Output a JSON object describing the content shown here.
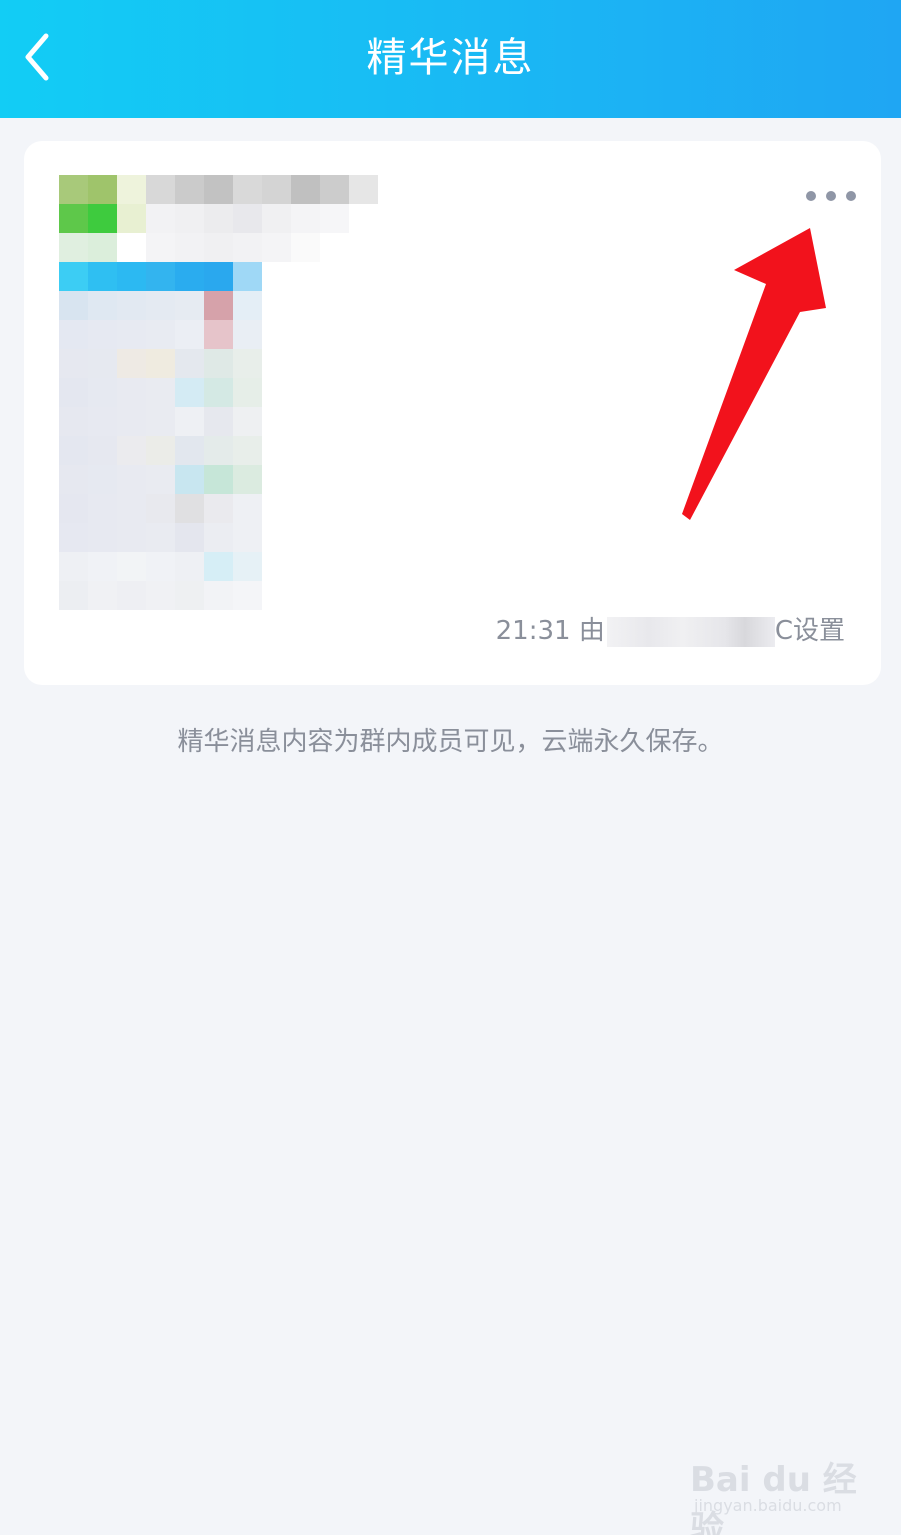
{
  "header": {
    "title": "精华消息",
    "back_icon": "chevron-left-icon"
  },
  "card": {
    "more_icon": "ellipsis-icon",
    "meta_time": "21:31",
    "meta_by": "由",
    "meta_suffix": "C设置"
  },
  "footer_note": "精华消息内容为群内成员可见，云端永久保存。",
  "watermark": {
    "logo": "Bai du 经验",
    "url": "jingyan.baidu.com"
  },
  "colors": {
    "header_start": "#12cdf5",
    "header_end": "#1fa6f3",
    "background": "#f3f5f9",
    "annotation_arrow": "#f2121c"
  }
}
